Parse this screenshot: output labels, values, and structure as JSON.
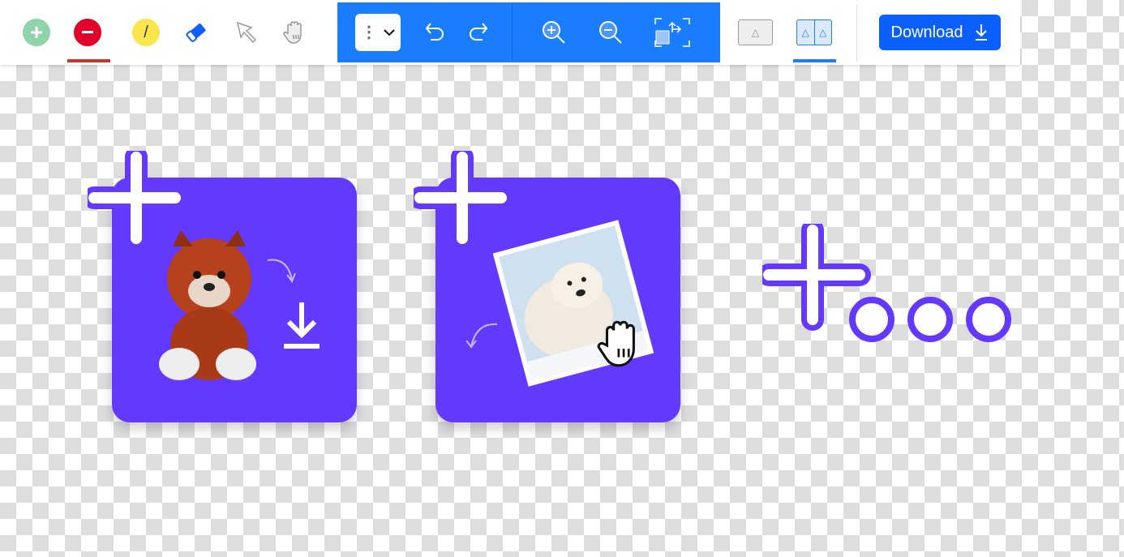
{
  "toolbar": {
    "tools": [
      {
        "name": "add-tool",
        "icon": "plus-circle-icon",
        "color": "#8fd3a8"
      },
      {
        "name": "remove-tool",
        "icon": "minus-circle-icon",
        "color": "#e2002b",
        "active": true
      },
      {
        "name": "brush-tool",
        "icon": "slash-circle-icon",
        "color": "#f9e64c"
      },
      {
        "name": "eraser-tool",
        "icon": "eraser-icon",
        "color": "#0b5fff"
      },
      {
        "name": "select-tool",
        "icon": "pointer-icon"
      },
      {
        "name": "pan-tool",
        "icon": "hand-icon"
      }
    ],
    "view_modes": {
      "single": "single-view",
      "split": "split-view",
      "active": "split"
    },
    "download_label": "Download",
    "accent": "#1a7cff",
    "active_underline": "#c8372d"
  },
  "canvas": {
    "card_color": "#6339ff",
    "cards": [
      {
        "subject": "teddy-fox-plush",
        "action": "download-icon"
      },
      {
        "subject": "white-dog-photo",
        "action": "hand-icon"
      }
    ]
  }
}
